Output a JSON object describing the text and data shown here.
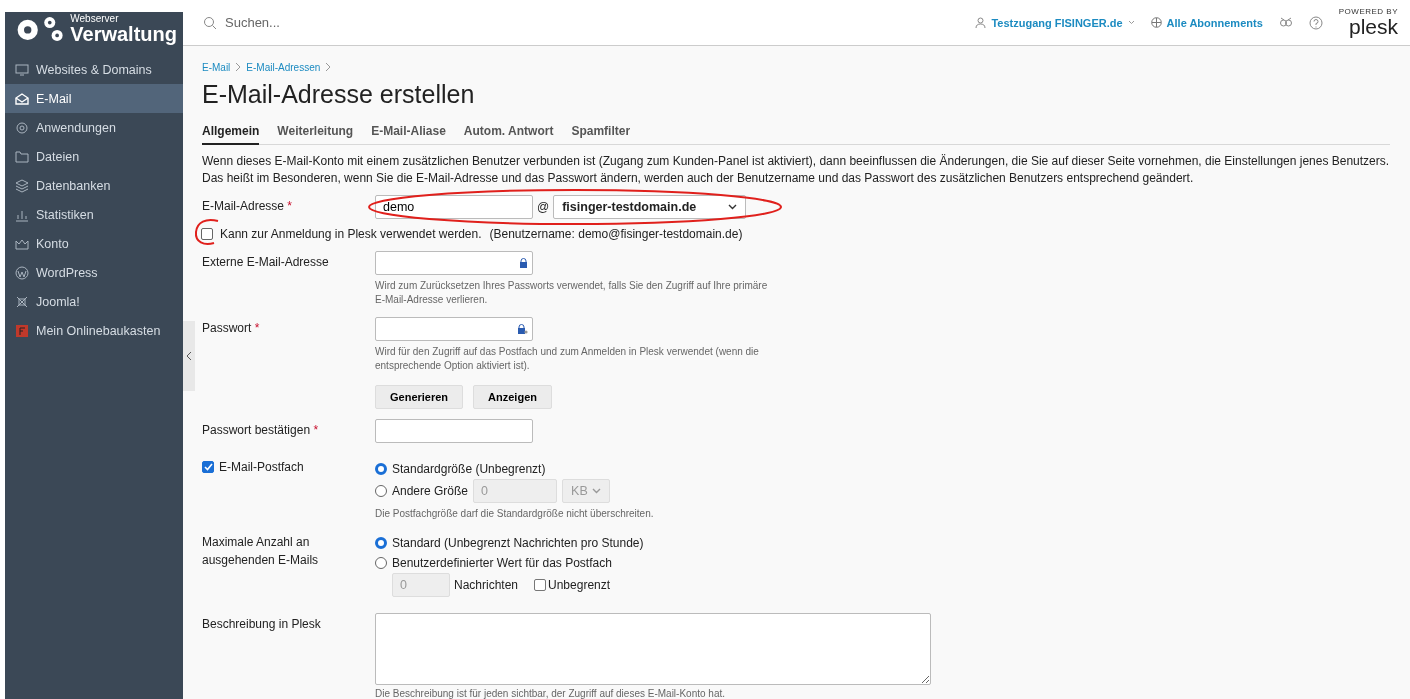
{
  "brand": {
    "small": "Webserver",
    "large": "Verwaltung"
  },
  "sidebar": {
    "items": [
      {
        "label": "Websites & Domains",
        "selected": false
      },
      {
        "label": "E-Mail",
        "selected": true
      },
      {
        "label": "Anwendungen",
        "selected": false
      },
      {
        "label": "Dateien",
        "selected": false
      },
      {
        "label": "Datenbanken",
        "selected": false
      },
      {
        "label": "Statistiken",
        "selected": false
      },
      {
        "label": "Konto",
        "selected": false
      },
      {
        "label": "WordPress",
        "selected": false
      },
      {
        "label": "Joomla!",
        "selected": false
      },
      {
        "label": "Mein Onlinebaukasten",
        "selected": false
      }
    ]
  },
  "header": {
    "search_placeholder": "Suchen...",
    "user": "Testzugang FISINGER.de",
    "subscriptions": "Alle Abonnements",
    "powered_by": "POWERED BY",
    "plesk": "plesk"
  },
  "breadcrumb": [
    "E-Mail",
    "E-Mail-Adressen"
  ],
  "title": "E-Mail-Adresse erstellen",
  "tabs": [
    {
      "label": "Allgemein",
      "selected": true
    },
    {
      "label": "Weiterleitung",
      "selected": false
    },
    {
      "label": "E-Mail-Aliase",
      "selected": false
    },
    {
      "label": "Autom. Antwort",
      "selected": false
    },
    {
      "label": "Spamfilter",
      "selected": false
    }
  ],
  "intro": "Wenn dieses E-Mail-Konto mit einem zusätzlichen Benutzer verbunden ist (Zugang zum Kunden-Panel ist aktiviert), dann beeinflussen die Änderungen, die Sie auf dieser Seite vornehmen, die Einstellungen jenes Benutzers. Das heißt im Besonderen, wenn Sie die E-Mail-Adresse und das Passwort ändern, werden auch der Benutzername und das Passwort des zusätzlichen Benutzers entsprechend geändert.",
  "email": {
    "label": "E-Mail-Adresse",
    "required_mark": "*",
    "value": "demo",
    "at": "@",
    "domain": "fisinger-testdomain.de",
    "highlighted": true
  },
  "login": {
    "checked": false,
    "label": "Kann zur Anmeldung in Plesk verwendet werden.",
    "username": "(Benutzername: demo@fisinger-testdomain.de)",
    "highlighted": true
  },
  "external": {
    "label": "Externe E-Mail-Adresse",
    "hint": "Wird zum Zurücksetzen Ihres Passworts verwendet, falls Sie den Zugriff auf Ihre primäre E-Mail-Adresse verlieren."
  },
  "password": {
    "label": "Passwort",
    "required_mark": "*",
    "hint": "Wird für den Zugriff auf das Postfach und zum Anmelden in Plesk verwendet (wenn die entsprechende Option aktiviert ist).",
    "buttons": [
      "Generieren",
      "Anzeigen"
    ]
  },
  "confirm": {
    "label": "Passwort bestätigen",
    "required_mark": "*"
  },
  "mailbox": {
    "checked": true,
    "label": "E-Mail-Postfach",
    "options": [
      {
        "label": "Standardgröße (Unbegrenzt)",
        "selected": true
      },
      {
        "label": "Andere Größe",
        "selected": false
      }
    ],
    "size_value": "0",
    "unit": "KB",
    "hint": "Die Postfachgröße darf die Standardgröße nicht überschreiten."
  },
  "outgoing": {
    "label": "Maximale Anzahl an ausgehenden E-Mails",
    "options": [
      {
        "label": "Standard (Unbegrenzt Nachrichten pro Stunde)",
        "selected": true
      },
      {
        "label": "Benutzerdefinierter Wert für das Postfach",
        "selected": false
      }
    ],
    "count_value": "0",
    "count_unit": "Nachrichten",
    "unlimited": {
      "label": "Unbegrenzt",
      "checked": false
    }
  },
  "description": {
    "label": "Beschreibung in Plesk",
    "hint": "Die Beschreibung ist für jeden sichtbar, der Zugriff auf dieses E-Mail-Konto hat."
  }
}
